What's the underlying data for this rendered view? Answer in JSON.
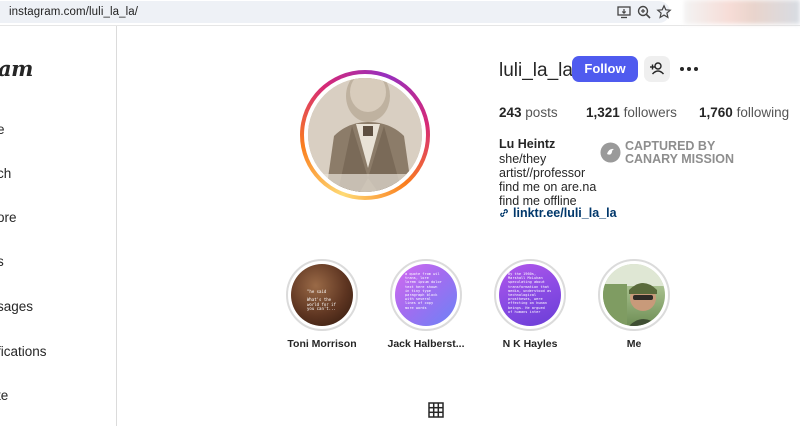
{
  "browser": {
    "url": "instagram.com/luli_la_la/",
    "icons": [
      "site-info-icon",
      "install-app-icon",
      "zoom-icon",
      "bookmark-star-icon"
    ]
  },
  "sidenav": {
    "logo_fragment": "am",
    "items": [
      {
        "label": "e",
        "icon": "home-icon"
      },
      {
        "label": "ch",
        "icon": "search-icon"
      },
      {
        "label": "ore",
        "icon": "explore-icon"
      },
      {
        "label": "s",
        "icon": "reels-icon"
      },
      {
        "label": "sages",
        "icon": "messages-icon"
      },
      {
        "label": "fications",
        "icon": "notifications-icon"
      },
      {
        "label": "te",
        "icon": "create-icon"
      }
    ]
  },
  "profile": {
    "username": "luli_la_la",
    "follow_label": "Follow",
    "stats": {
      "posts_count": "243",
      "posts_label": "posts",
      "followers_count": "1,321",
      "followers_label": "followers",
      "following_count": "1,760",
      "following_label": "following"
    },
    "bio": {
      "name": "Lu Heintz",
      "lines": [
        "she/they",
        "artist//professor",
        "find me on are.na",
        "find me offline"
      ],
      "link": "linktr.ee/luli_la_la"
    },
    "watermark": {
      "line1": "CAPTURED BY",
      "line2": "CANARY MISSION"
    }
  },
  "highlights": [
    {
      "label": "Toni Morrison",
      "colors": [
        "#7a4a2c",
        "#3b2013"
      ]
    },
    {
      "label": "Jack Halberst...",
      "colors": [
        "#c26bf0",
        "#6a7df5"
      ]
    },
    {
      "label": "N K Hayles",
      "colors": [
        "#a54ee8",
        "#6d3fd8"
      ]
    },
    {
      "label": "Me",
      "colors": [
        "#8aa66a",
        "#5c7a48"
      ]
    }
  ],
  "colors": {
    "follow_button": "#4f5bef",
    "link": "#00376b",
    "watermark": "#8e8e8e"
  }
}
